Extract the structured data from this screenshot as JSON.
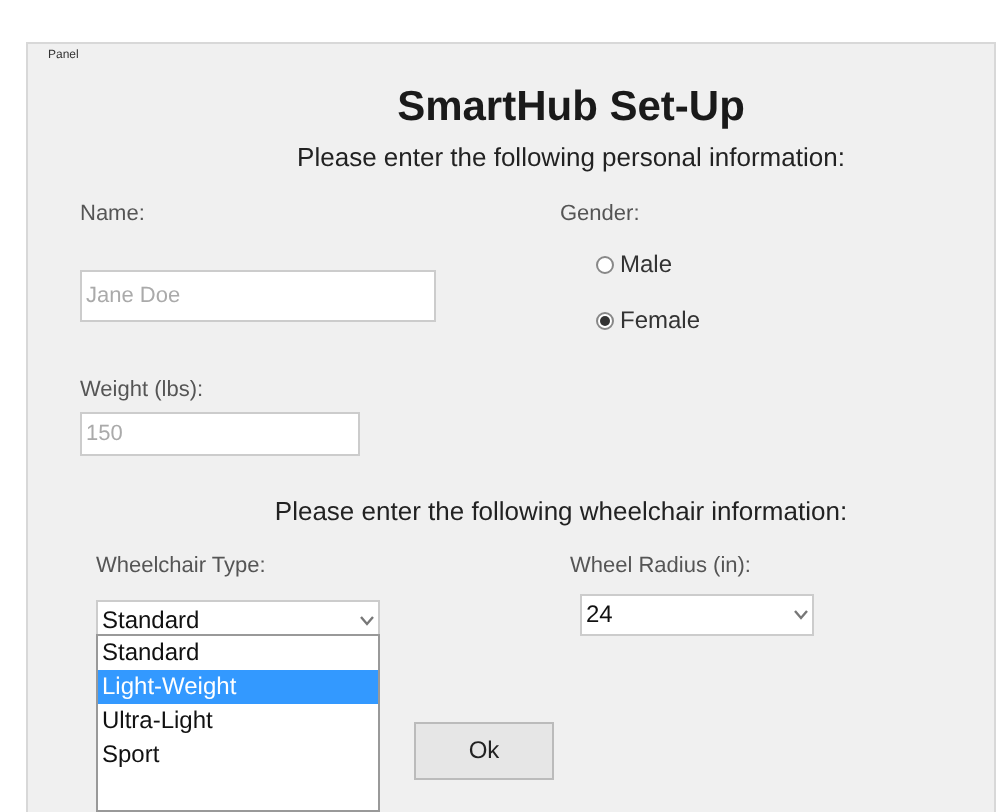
{
  "panel": {
    "label": "Panel"
  },
  "title": "SmartHub Set-Up",
  "personal_heading": "Please enter the following personal information:",
  "name": {
    "label": "Name:",
    "placeholder": "Jane Doe"
  },
  "gender": {
    "label": "Gender:",
    "options": [
      {
        "label": "Male",
        "selected": false
      },
      {
        "label": "Female",
        "selected": true
      }
    ]
  },
  "weight": {
    "label": "Weight (lbs):",
    "placeholder": "150"
  },
  "wheelchair_heading": "Please enter the following wheelchair information:",
  "wheelchair_type": {
    "label": "Wheelchair Type:",
    "value": "Standard",
    "expanded": true,
    "options": [
      {
        "label": "Standard",
        "highlighted": false
      },
      {
        "label": "Light-Weight",
        "highlighted": true
      },
      {
        "label": "Ultra-Light",
        "highlighted": false
      },
      {
        "label": "Sport",
        "highlighted": false
      }
    ]
  },
  "wheel_radius": {
    "label": "Wheel Radius (in):",
    "value": "24"
  },
  "ok_button": "Ok"
}
